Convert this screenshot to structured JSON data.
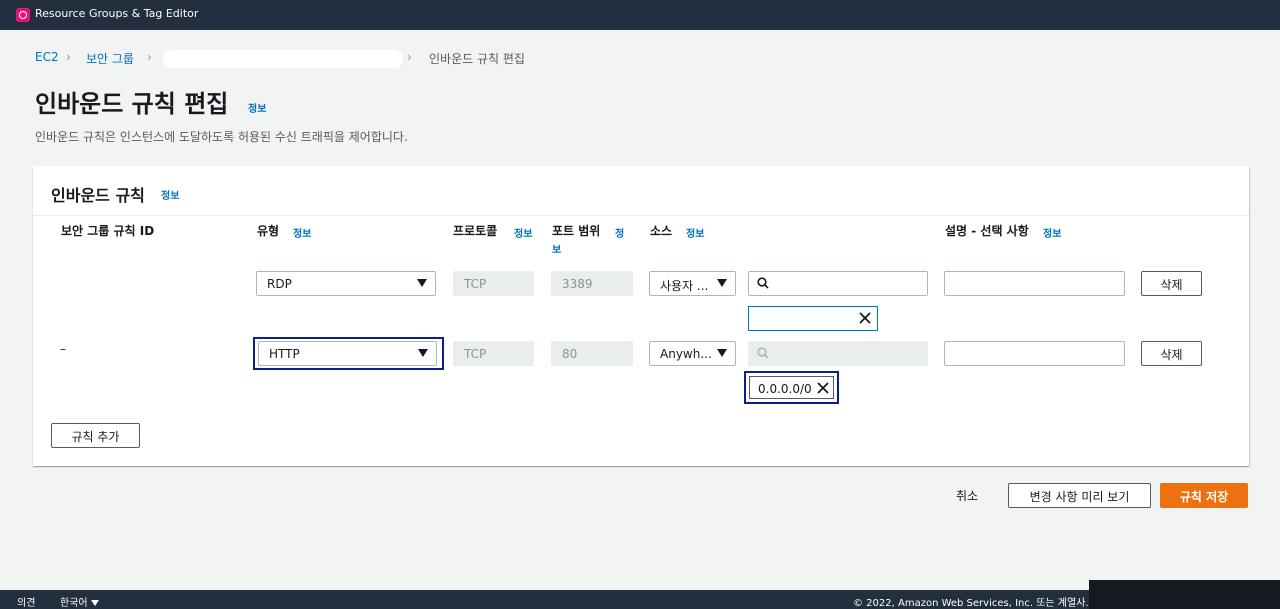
{
  "app": {
    "title": "Resource Groups & Tag Editor",
    "accent": "#e7157b"
  },
  "breadcrumb": {
    "items": [
      "EC2",
      "보안 그룹"
    ],
    "current": "인바운드 규칙 편집"
  },
  "page": {
    "title": "인바운드 규칙 편집",
    "info_label": "정보",
    "description": "인바운드 규칙은 인스턴스에 도달하도록 허용된 수신 트래픽을 제어합니다."
  },
  "panel": {
    "title": "인바운드 규칙",
    "info_label": "정보",
    "columns": {
      "rule_id": "보안 그룹 규칙 ID",
      "type": "유형",
      "protocol": "프로토콜",
      "port_range_line1": "포트 범위",
      "port_info_line1": "정",
      "port_info_line2": "보",
      "source": "소스",
      "description": "설명 - 선택 사항"
    },
    "rows": [
      {
        "rule_id": "",
        "type": "RDP",
        "protocol": "TCP",
        "port": "3389",
        "source": "사용자 ...",
        "cidr": "",
        "token": "",
        "description": "",
        "delete_label": "삭제"
      },
      {
        "rule_id": "–",
        "type": "HTTP",
        "protocol": "TCP",
        "port": "80",
        "source": "Anywh...",
        "cidr": "",
        "token": "0.0.0.0/0",
        "description": "",
        "delete_label": "삭제"
      }
    ],
    "add_rule_label": "규칙 추가"
  },
  "actions": {
    "cancel": "취소",
    "preview": "변경 사항 미리 보기",
    "save": "규칙 저장"
  },
  "footer": {
    "feedback": "의견",
    "language": "한국어",
    "copyright": "© 2022, Amazon Web Services, Inc. 또는 계열사."
  },
  "colors": {
    "primary": "#ec7211",
    "link": "#0073bb",
    "focus": "#0b1e8a",
    "topbar": "#232f3e"
  }
}
